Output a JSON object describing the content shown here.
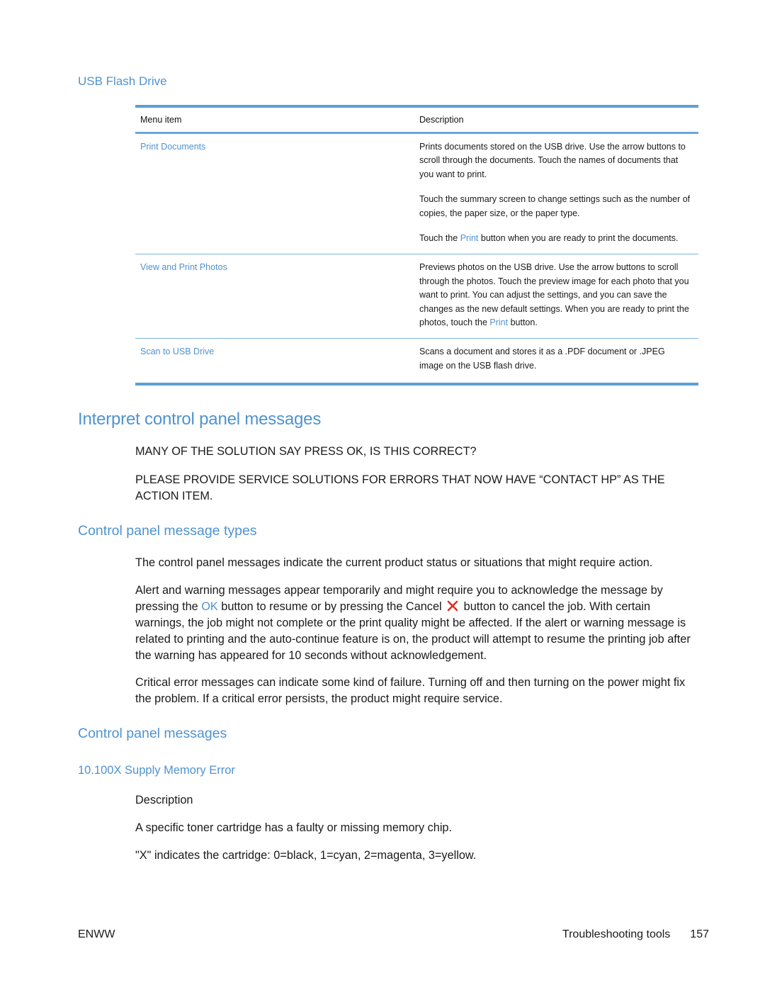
{
  "usb_section": {
    "heading": "USB Flash Drive",
    "table": {
      "headers": [
        "Menu item",
        "Description"
      ],
      "rows": [
        {
          "item": "Print Documents",
          "description": [
            {
              "text": "Prints documents stored on the USB drive. Use the arrow buttons to scroll through the documents. Touch the names of documents that you want to print."
            },
            {
              "text": "Touch the summary screen to change settings such as the number of copies, the paper size, or the paper type."
            },
            {
              "before": "Touch the ",
              "link": "Print",
              "after": " button when you are ready to print the documents."
            }
          ]
        },
        {
          "item": "View and Print Photos",
          "description": [
            {
              "before": "Previews photos on the USB drive. Use the arrow buttons to scroll through the photos. Touch the preview image for each photo that you want to print. You can adjust the settings, and you can save the changes as the new default settings. When you are ready to print the photos, touch the ",
              "link": "Print",
              "after": " button."
            }
          ]
        },
        {
          "item": "Scan to USB Drive",
          "description": [
            {
              "text": "Scans a document and stores it as a .PDF document or .JPEG image on the USB flash drive."
            }
          ]
        }
      ]
    }
  },
  "interpret": {
    "heading": "Interpret control panel messages",
    "notes": [
      "MANY OF THE SOLUTION SAY PRESS OK, IS THIS CORRECT?",
      "PLEASE PROVIDE SERVICE SOLUTIONS FOR ERRORS THAT NOW HAVE “CONTACT HP” AS THE ACTION ITEM."
    ]
  },
  "message_types": {
    "heading": "Control panel message types",
    "para1": "The control panel messages indicate the current product status or situations that might require action.",
    "para2": {
      "part1": "Alert and warning messages appear temporarily and might require you to acknowledge the message by pressing the ",
      "ok_label": "OK",
      "part2": " button to resume or by pressing the Cancel",
      "cancel_icon": "cancel-x-icon",
      "part3": " button to cancel the job. With certain warnings, the job might not complete or the print quality might be affected. If the alert or warning message is related to printing and the auto-continue feature is on, the product will attempt to resume the printing job after the warning has appeared for 10 seconds without acknowledgement."
    },
    "para3": "Critical error messages can indicate some kind of failure. Turning off and then turning on the power might fix the problem. If a critical error persists, the product might require service."
  },
  "messages": {
    "heading": "Control panel messages",
    "error_title": "10.100X Supply Memory Error",
    "description_label": "Description",
    "description_lines": [
      "A specific toner cartridge has a faulty or missing memory chip.",
      "\"X\" indicates the cartridge: 0=black, 1=cyan, 2=magenta, 3=yellow."
    ]
  },
  "footer": {
    "left": "ENWW",
    "section": "Troubleshooting tools",
    "page_number": "157"
  },
  "colors": {
    "accent_blue": "#4f93cf",
    "rule_blue": "#5b9fd6",
    "cancel_red": "#d9342b",
    "text": "#1a1a1a"
  }
}
